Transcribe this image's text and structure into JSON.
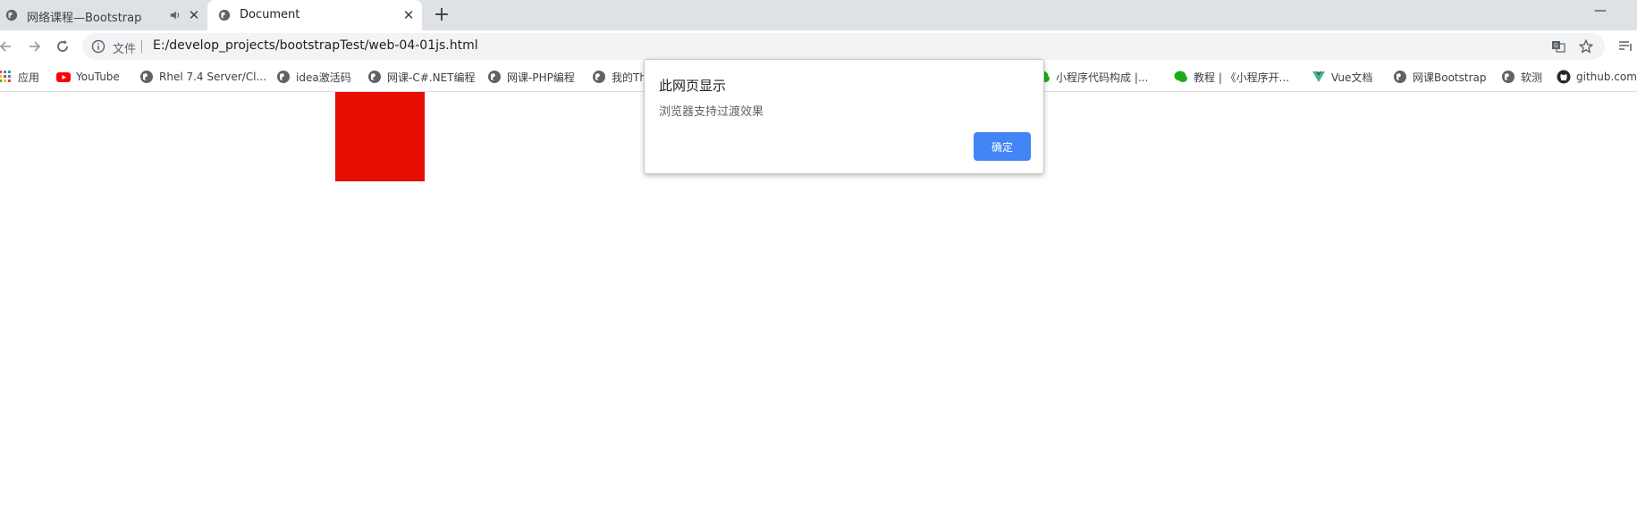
{
  "tabs": [
    {
      "title": "网络课程—Bootstrap",
      "active": false,
      "audio": true
    },
    {
      "title": "Document",
      "active": true
    }
  ],
  "toolbar": {
    "file_label": "文件",
    "url": "E:/develop_projects/bootstrapTest/web-04-01js.html"
  },
  "bookmarks": [
    {
      "label": "应用",
      "icon": "apps-grid-icon"
    },
    {
      "label": "YouTube",
      "icon": "youtube-icon"
    },
    {
      "label": "Rhel 7.4 Server/Cl...",
      "icon": "globe-icon"
    },
    {
      "label": "idea激活码",
      "icon": "globe-icon"
    },
    {
      "label": "网课-C#.NET编程",
      "icon": "globe-icon"
    },
    {
      "label": "网课-PHP编程",
      "icon": "globe-icon"
    },
    {
      "label": "我的Th",
      "icon": "globe-icon"
    },
    {
      "label": "小程序代码构成 |...",
      "icon": "wechat-icon"
    },
    {
      "label": "教程 | 《小程序开...",
      "icon": "wechat-icon"
    },
    {
      "label": "Vue文档",
      "icon": "vue-icon"
    },
    {
      "label": "网课Bootstrap",
      "icon": "globe-icon"
    },
    {
      "label": "软测",
      "icon": "globe-icon"
    },
    {
      "label": "github.com",
      "icon": "github-icon"
    }
  ],
  "dialog": {
    "title": "此网页显示",
    "message": "浏览器支持过渡效果",
    "ok_label": "确定"
  },
  "colors": {
    "red_box": "#e60d02",
    "ok_button": "#4285f4",
    "tab_strip": "#dee1e6"
  }
}
